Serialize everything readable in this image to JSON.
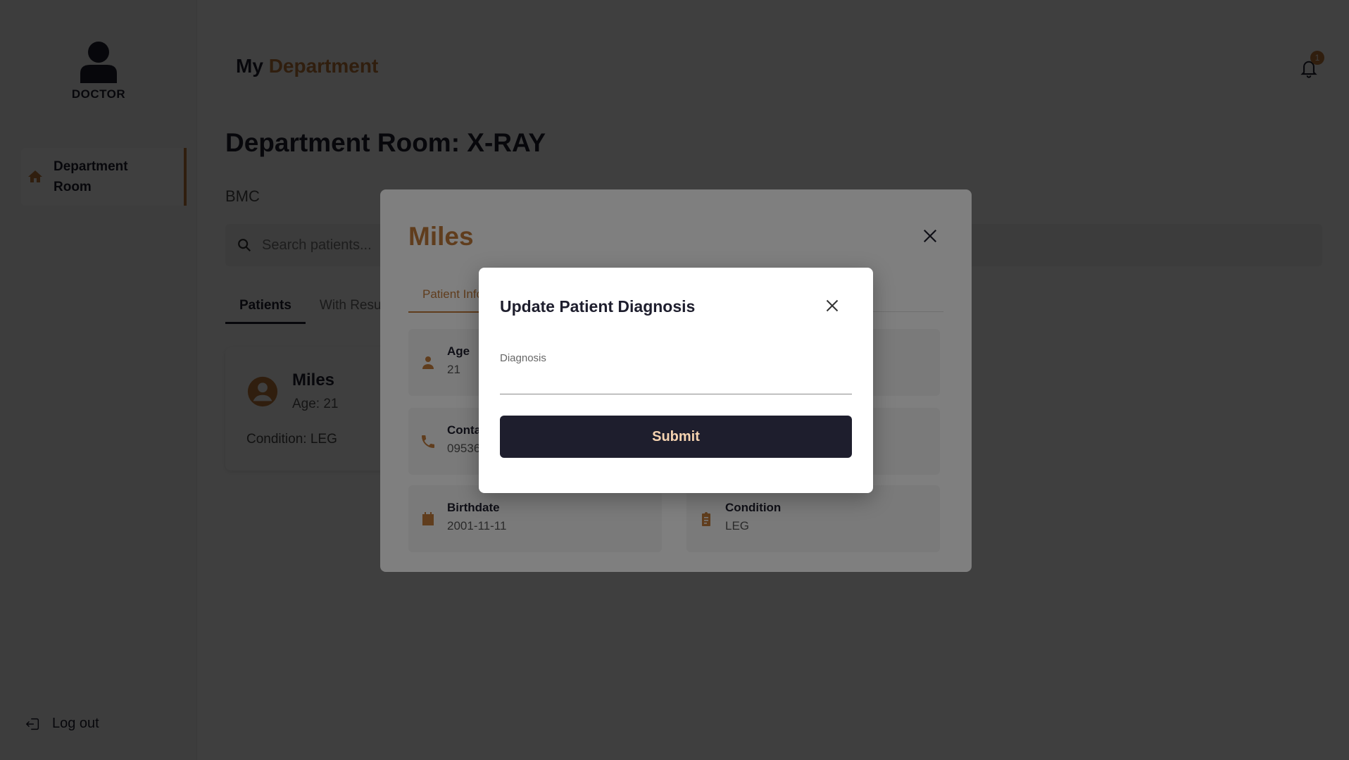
{
  "sidebar": {
    "role": "DOCTOR",
    "nav": [
      {
        "label": "Department Room"
      }
    ],
    "logout": "Log out"
  },
  "header": {
    "title_prefix": "My",
    "title_accent": "Department",
    "notifications_count": "1"
  },
  "main": {
    "page_title": "Department Room: X-RAY",
    "subtitle": "BMC",
    "search_placeholder": "Search patients...",
    "tabs": [
      {
        "label": "Patients"
      },
      {
        "label": "With Results"
      }
    ],
    "patient_card": {
      "name": "Miles",
      "age": "Age: 21",
      "condition": "Condition: LEG"
    }
  },
  "patient_modal": {
    "name": "Miles",
    "tab": "Patient Info",
    "info": [
      {
        "label": "Age",
        "value": "21",
        "icon": "person-icon"
      },
      {
        "label": "Contact",
        "value": "09536",
        "icon": "phone-icon"
      },
      {
        "label": "Birthdate",
        "value": "2001-11-11",
        "icon": "calendar-icon"
      },
      {
        "label": "Condition",
        "value": "LEG",
        "icon": "clipboard-icon"
      }
    ]
  },
  "dialog": {
    "title": "Update Patient Diagnosis",
    "field_label": "Diagnosis",
    "field_value": "",
    "submit": "Submit"
  },
  "colors": {
    "accent": "#c07a3a",
    "primary_dark": "#1e1e2d",
    "button_text": "#f5d3b0"
  }
}
